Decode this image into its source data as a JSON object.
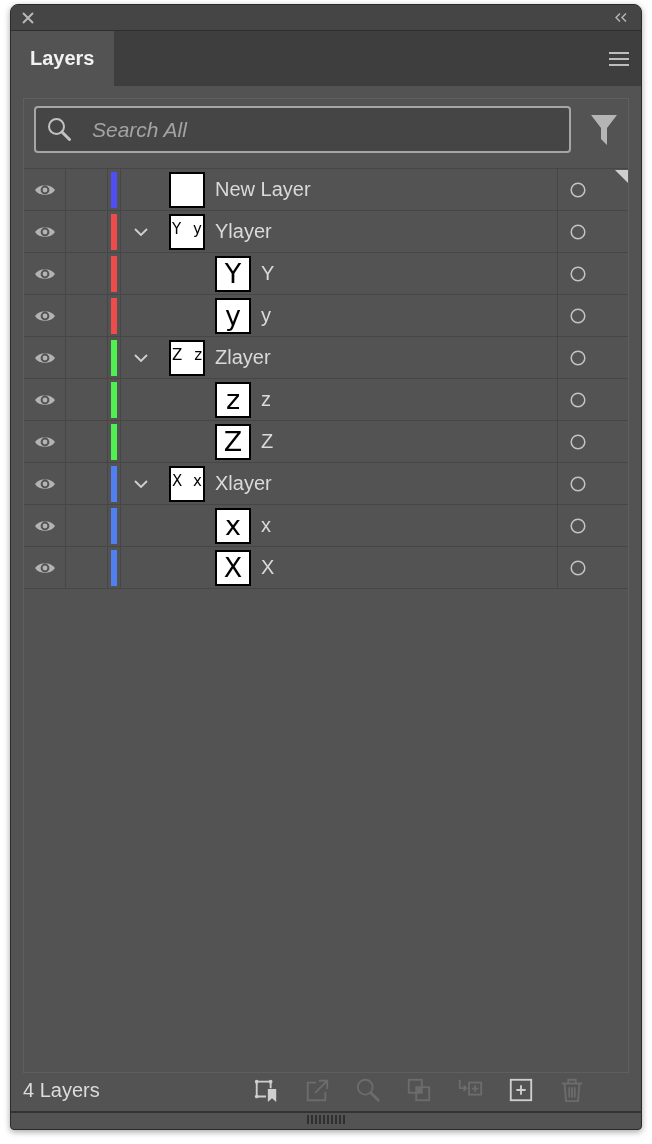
{
  "tabs": [
    {
      "label": "Layers",
      "selected": true
    }
  ],
  "search": {
    "placeholder": "Search All"
  },
  "layers": [
    {
      "name": "New Layer",
      "color": "#4f4ff5",
      "visible": true,
      "targeted": false,
      "selected": true
    },
    {
      "name": "Ylayer",
      "thumbnail": [
        "Y",
        "y"
      ],
      "color": "#f04b4b",
      "visible": true,
      "targeted": false,
      "selected": false,
      "expanded": true,
      "children": [
        {
          "name": "Y",
          "thumbnail": [
            "Y"
          ],
          "color": "#f04b4b",
          "visible": true,
          "targeted": false,
          "selected": false
        },
        {
          "name": "y",
          "thumbnail": [
            "y"
          ],
          "color": "#f04b4b",
          "visible": true,
          "targeted": false,
          "selected": false
        }
      ]
    },
    {
      "name": "Zlayer",
      "thumbnail": [
        "Z",
        "z"
      ],
      "color": "#4ff04f",
      "visible": true,
      "targeted": false,
      "selected": false,
      "expanded": true,
      "children": [
        {
          "name": "z",
          "thumbnail": [
            "z"
          ],
          "color": "#4ff04f",
          "visible": true,
          "targeted": false,
          "selected": false
        },
        {
          "name": "Z",
          "thumbnail": [
            "Z"
          ],
          "color": "#4ff04f",
          "visible": true,
          "targeted": false,
          "selected": false
        }
      ]
    },
    {
      "name": "Xlayer",
      "thumbnail": [
        "X",
        "x"
      ],
      "color": "#4f7ff0",
      "visible": true,
      "targeted": false,
      "selected": false,
      "expanded": true,
      "children": [
        {
          "name": "x",
          "thumbnail": [
            "x"
          ],
          "color": "#4f7ff0",
          "visible": true,
          "targeted": false,
          "selected": false
        },
        {
          "name": "X",
          "thumbnail": [
            "X"
          ],
          "color": "#4f7ff0",
          "visible": true,
          "targeted": false,
          "selected": false
        }
      ]
    }
  ],
  "status": "4 Layers",
  "toolbar": [
    {
      "kind": "collect",
      "disabled": false
    },
    {
      "kind": "export",
      "disabled": true
    },
    {
      "kind": "locate",
      "disabled": true
    },
    {
      "kind": "mask",
      "disabled": true
    },
    {
      "kind": "move",
      "disabled": true
    },
    {
      "kind": "add",
      "disabled": false
    },
    {
      "kind": "delete",
      "disabled": true
    }
  ]
}
